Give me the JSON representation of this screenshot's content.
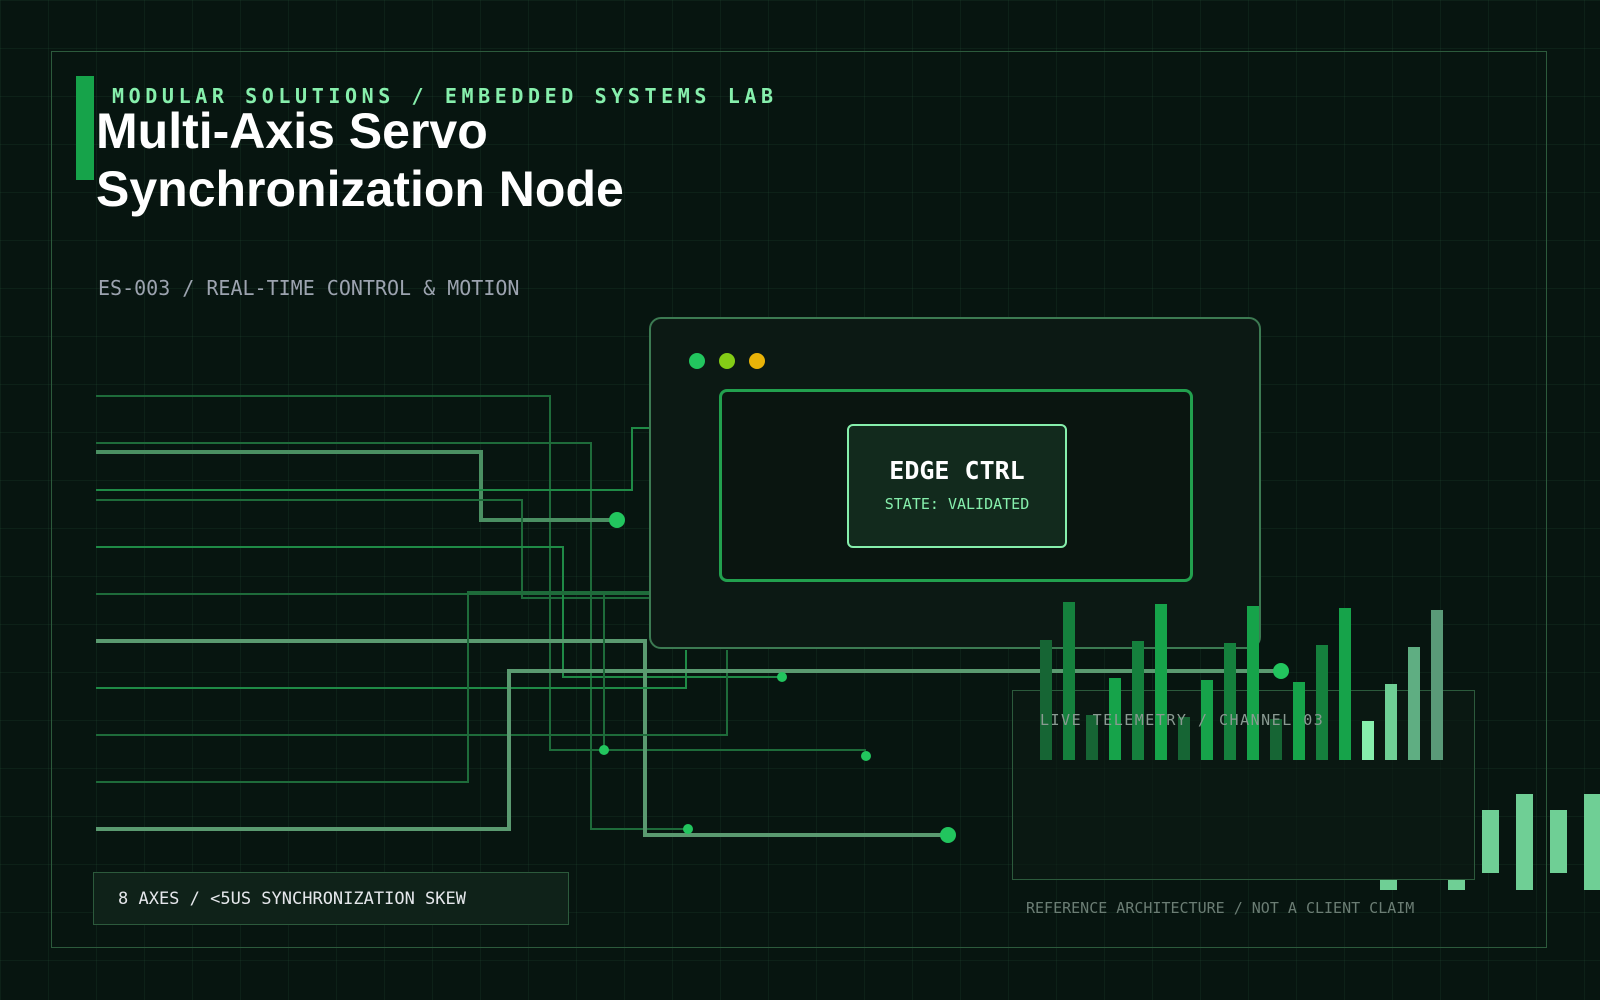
{
  "eyebrow": "MODULAR SOLUTIONS / EMBEDDED SYSTEMS LAB",
  "title": "Multi-Axis Servo Synchronization Node",
  "subtitle": "ES-003 / REAL-TIME CONTROL & MOTION",
  "device": {
    "controller_title": "EDGE CTRL",
    "controller_state": "STATE: VALIDATED"
  },
  "telemetry": {
    "label": "LIVE TELEMETRY / CHANNEL 03"
  },
  "stat": "8 AXES / <5US SYNCHRONIZATION SKEW",
  "footnote": "REFERENCE ARCHITECTURE / NOT A CLIENT CLAIM",
  "colors": {
    "background": "#071510",
    "accent": "#16a34a",
    "accent_light": "#86efac",
    "trace": "#22c55e",
    "status_green": "#22c55e",
    "status_lime": "#84cc16",
    "status_amber": "#eab308"
  }
}
